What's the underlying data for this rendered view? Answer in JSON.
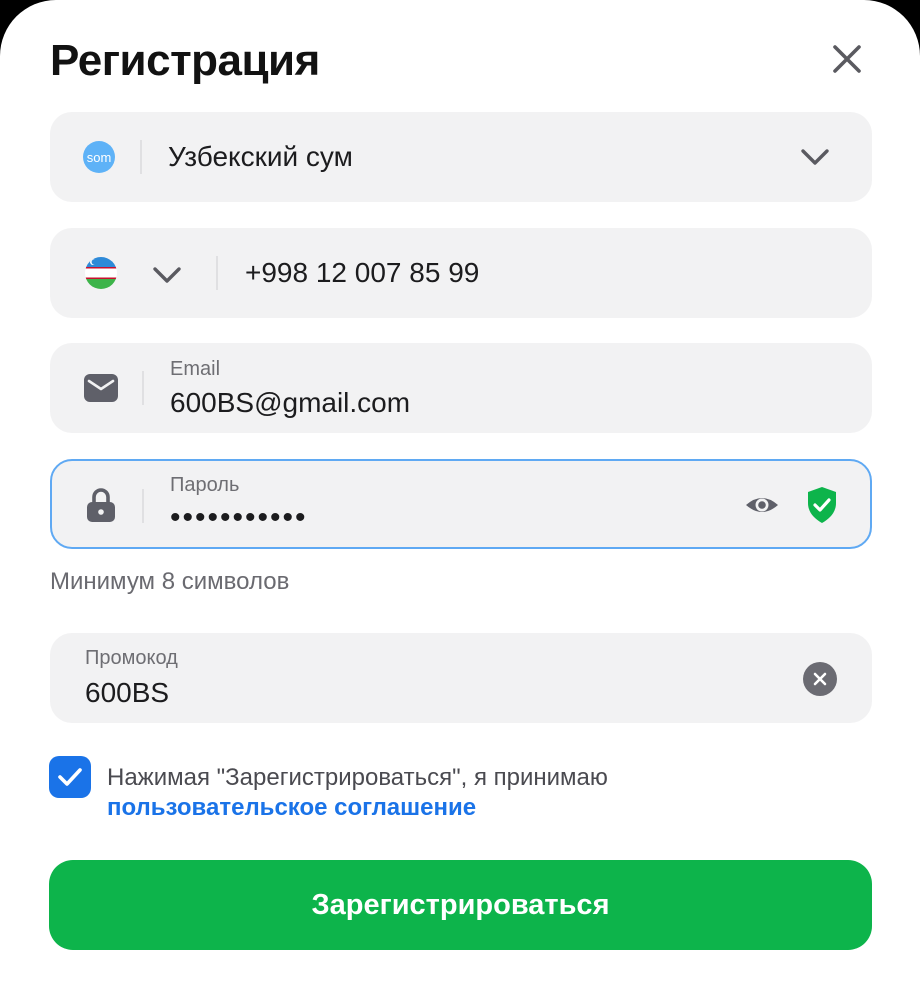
{
  "header": {
    "title": "Регистрация"
  },
  "currency": {
    "badge": "som",
    "value": "Узбекский сум"
  },
  "phone": {
    "value": "+998 12 007 85 99"
  },
  "email": {
    "label": "Email",
    "value": "600BS@gmail.com"
  },
  "password": {
    "label": "Пароль",
    "value": "•••••••••••",
    "hint": "Минимум 8 символов"
  },
  "promo": {
    "label": "Промокод",
    "value": "600BS"
  },
  "agreement": {
    "text": "Нажимая \"Зарегистрироваться\", я принимаю",
    "link": "пользовательское соглашение",
    "checked": true
  },
  "submit": {
    "label": "Зарегистрироваться"
  },
  "colors": {
    "accent": "#1a73e8",
    "primary_button": "#0db44b",
    "focus_border": "#5fa9f3",
    "shield": "#0db44b"
  }
}
